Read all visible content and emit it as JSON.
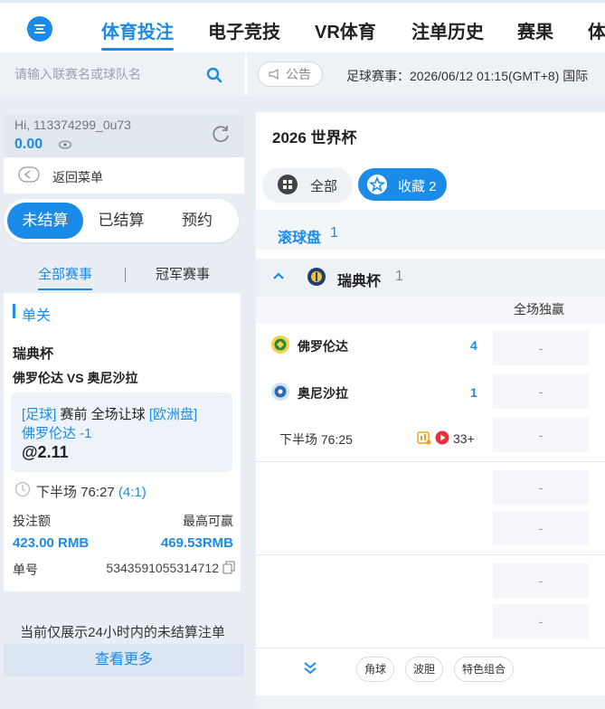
{
  "nav": {
    "tabs": [
      "体育投注",
      "电子竞技",
      "VR体育",
      "注单历史",
      "赛果",
      "体"
    ],
    "active_index": 0
  },
  "search": {
    "placeholder": "请输入联赛名或球队名"
  },
  "notice": {
    "label": "公告",
    "text": "足球赛事：2026/06/12 01:15(GMT+8) 国际"
  },
  "account": {
    "greeting": "Hi, 113374299_0u73",
    "balance": "0.00"
  },
  "back_menu": "返回菜单",
  "bet_status_tabs": [
    "未结算",
    "已结算",
    "预约"
  ],
  "bet_category_tabs": [
    "全部赛事",
    "冠军赛事"
  ],
  "bet_slip": {
    "type_label": "单关",
    "league": "瑞典杯",
    "match": "佛罗伦达 VS 奥尼沙拉",
    "sport_tag": "[足球]",
    "bet_desc": "赛前 全场让球",
    "market_tag": "[欧洲盘]",
    "selection": "佛罗伦达 -1",
    "odds": "@2.11",
    "period": "下半场",
    "clock": "76:27",
    "score": "(4:1)",
    "stake_label": "投注额",
    "max_win_label": "最高可赢",
    "stake": "423.00 RMB",
    "max_win": "469.53RMB",
    "id_label": "单号",
    "id": "5343591055314712"
  },
  "only24_note": "当前仅展示24小时内的未结算注单",
  "view_more": "查看更多",
  "event": {
    "title": "2026 世界杯",
    "filter_all": "全部",
    "filter_fav": "收藏 2",
    "inplay_label": "滚球盘",
    "inplay_count": "1",
    "league": "瑞典杯",
    "league_count": "1",
    "market_header": "全场独赢",
    "home": {
      "name": "佛罗伦达",
      "score": "4"
    },
    "away": {
      "name": "奥尼沙拉",
      "score": "1"
    },
    "period": "下半场",
    "clock": "76:25",
    "more_markets": "33+",
    "empty_odd": "-",
    "chips": [
      "角球",
      "波胆",
      "特色组合"
    ]
  },
  "colors": {
    "brand": "#1a8be8",
    "bg": "#e9eef4"
  }
}
